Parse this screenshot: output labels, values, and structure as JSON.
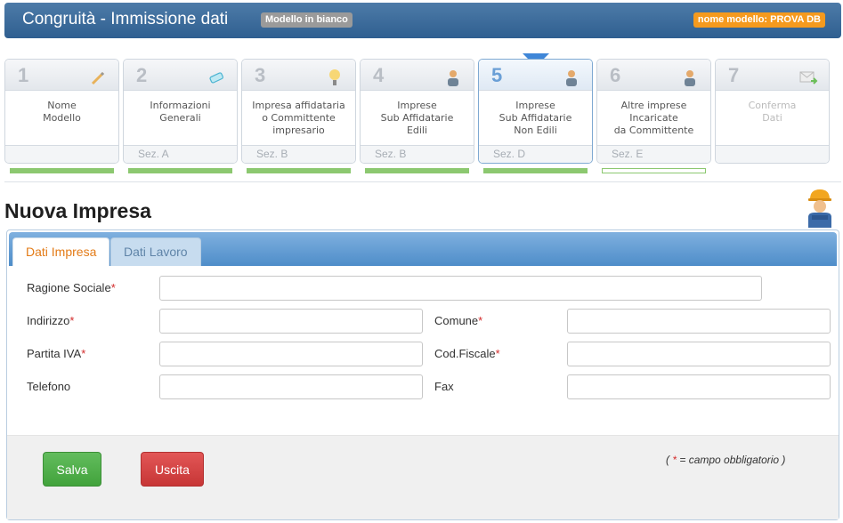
{
  "header": {
    "title": "Congruità - Immissione dati",
    "blank_badge": "Modello in bianco",
    "model_badge": "nome modello:  PROVA DB"
  },
  "steps": [
    {
      "num": "1",
      "label": "Nome\nModello",
      "sez": "",
      "icon": "pencil-icon",
      "state": "done"
    },
    {
      "num": "2",
      "label": "Informazioni\nGenerali",
      "sez": "Sez. A",
      "icon": "eraser-icon",
      "state": "done"
    },
    {
      "num": "3",
      "label": "Impresa affidataria\no Committente\nimpresario",
      "sez": "Sez. B",
      "icon": "bulb-icon",
      "state": "done"
    },
    {
      "num": "4",
      "label": "Imprese\nSub Affidatarie\nEdili",
      "sez": "Sez. B",
      "icon": "worker-icon",
      "state": "done"
    },
    {
      "num": "5",
      "label": "Imprese\nSub Affidatarie\nNon Edili",
      "sez": "Sez. D",
      "icon": "worker-icon",
      "state": "active"
    },
    {
      "num": "6",
      "label": "Altre imprese\nIncaricate\nda Committente",
      "sez": "Sez. E",
      "icon": "worker-icon",
      "state": "pending"
    },
    {
      "num": "7",
      "label": "Conferma\nDati",
      "sez": "",
      "icon": "envelope-arrow-icon",
      "state": "disabled"
    }
  ],
  "section_title": "Nuova Impresa",
  "tabs": [
    {
      "label": "Dati Impresa",
      "active": true
    },
    {
      "label": "Dati Lavoro",
      "active": false
    }
  ],
  "form": {
    "ragione_sociale": {
      "label": "Ragione Sociale",
      "required": "*",
      "value": ""
    },
    "indirizzo": {
      "label": "Indirizzo",
      "required": "*",
      "value": ""
    },
    "comune": {
      "label": "Comune",
      "required": "*",
      "value": ""
    },
    "partita_iva": {
      "label": "Partita IVA",
      "required": "*",
      "value": ""
    },
    "cod_fiscale": {
      "label": "Cod.Fiscale",
      "required": "*",
      "value": ""
    },
    "telefono": {
      "label": "Telefono",
      "value": ""
    },
    "fax": {
      "label": "Fax",
      "value": ""
    }
  },
  "buttons": {
    "save": "Salva",
    "exit": "Uscita"
  },
  "note": {
    "open": "( ",
    "star": "*",
    "text": " = campo obbligatorio )"
  },
  "colors": {
    "header": "#3d6d9e",
    "accent": "#e37b17",
    "save": "#4cae46",
    "exit": "#d64545",
    "progress": "#8cc870"
  }
}
